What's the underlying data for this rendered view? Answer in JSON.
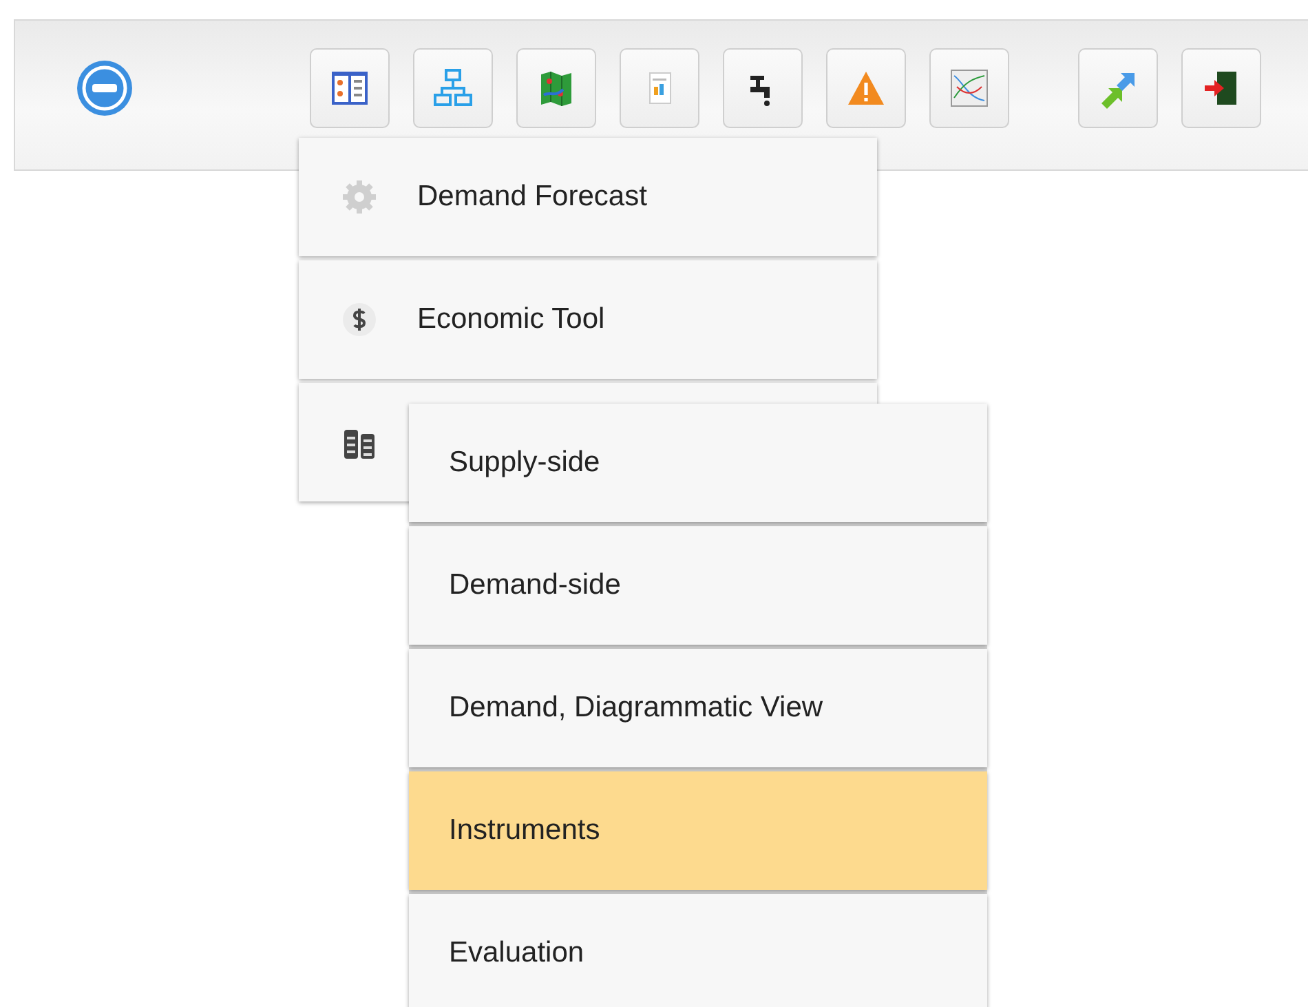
{
  "toolbar": {
    "buttons": [
      {
        "kind": "panel"
      },
      {
        "kind": "hierarchy"
      },
      {
        "kind": "map"
      },
      {
        "kind": "report"
      },
      {
        "kind": "tap"
      },
      {
        "kind": "warning"
      },
      {
        "kind": "chart"
      },
      {
        "kind": "exchange"
      },
      {
        "kind": "exit"
      }
    ]
  },
  "menu": {
    "items": [
      {
        "kind": "gear",
        "label": "Demand Forecast"
      },
      {
        "kind": "dollar",
        "label": "Economic Tool"
      },
      {
        "kind": "buildings"
      }
    ]
  },
  "submenu": {
    "items": [
      {
        "label": "Supply-side",
        "selected": false
      },
      {
        "label": "Demand-side",
        "selected": false
      },
      {
        "label": "Demand, Diagrammatic View",
        "selected": false
      },
      {
        "label": "Instruments",
        "selected": true
      },
      {
        "label": "Evaluation",
        "selected": false
      }
    ]
  }
}
